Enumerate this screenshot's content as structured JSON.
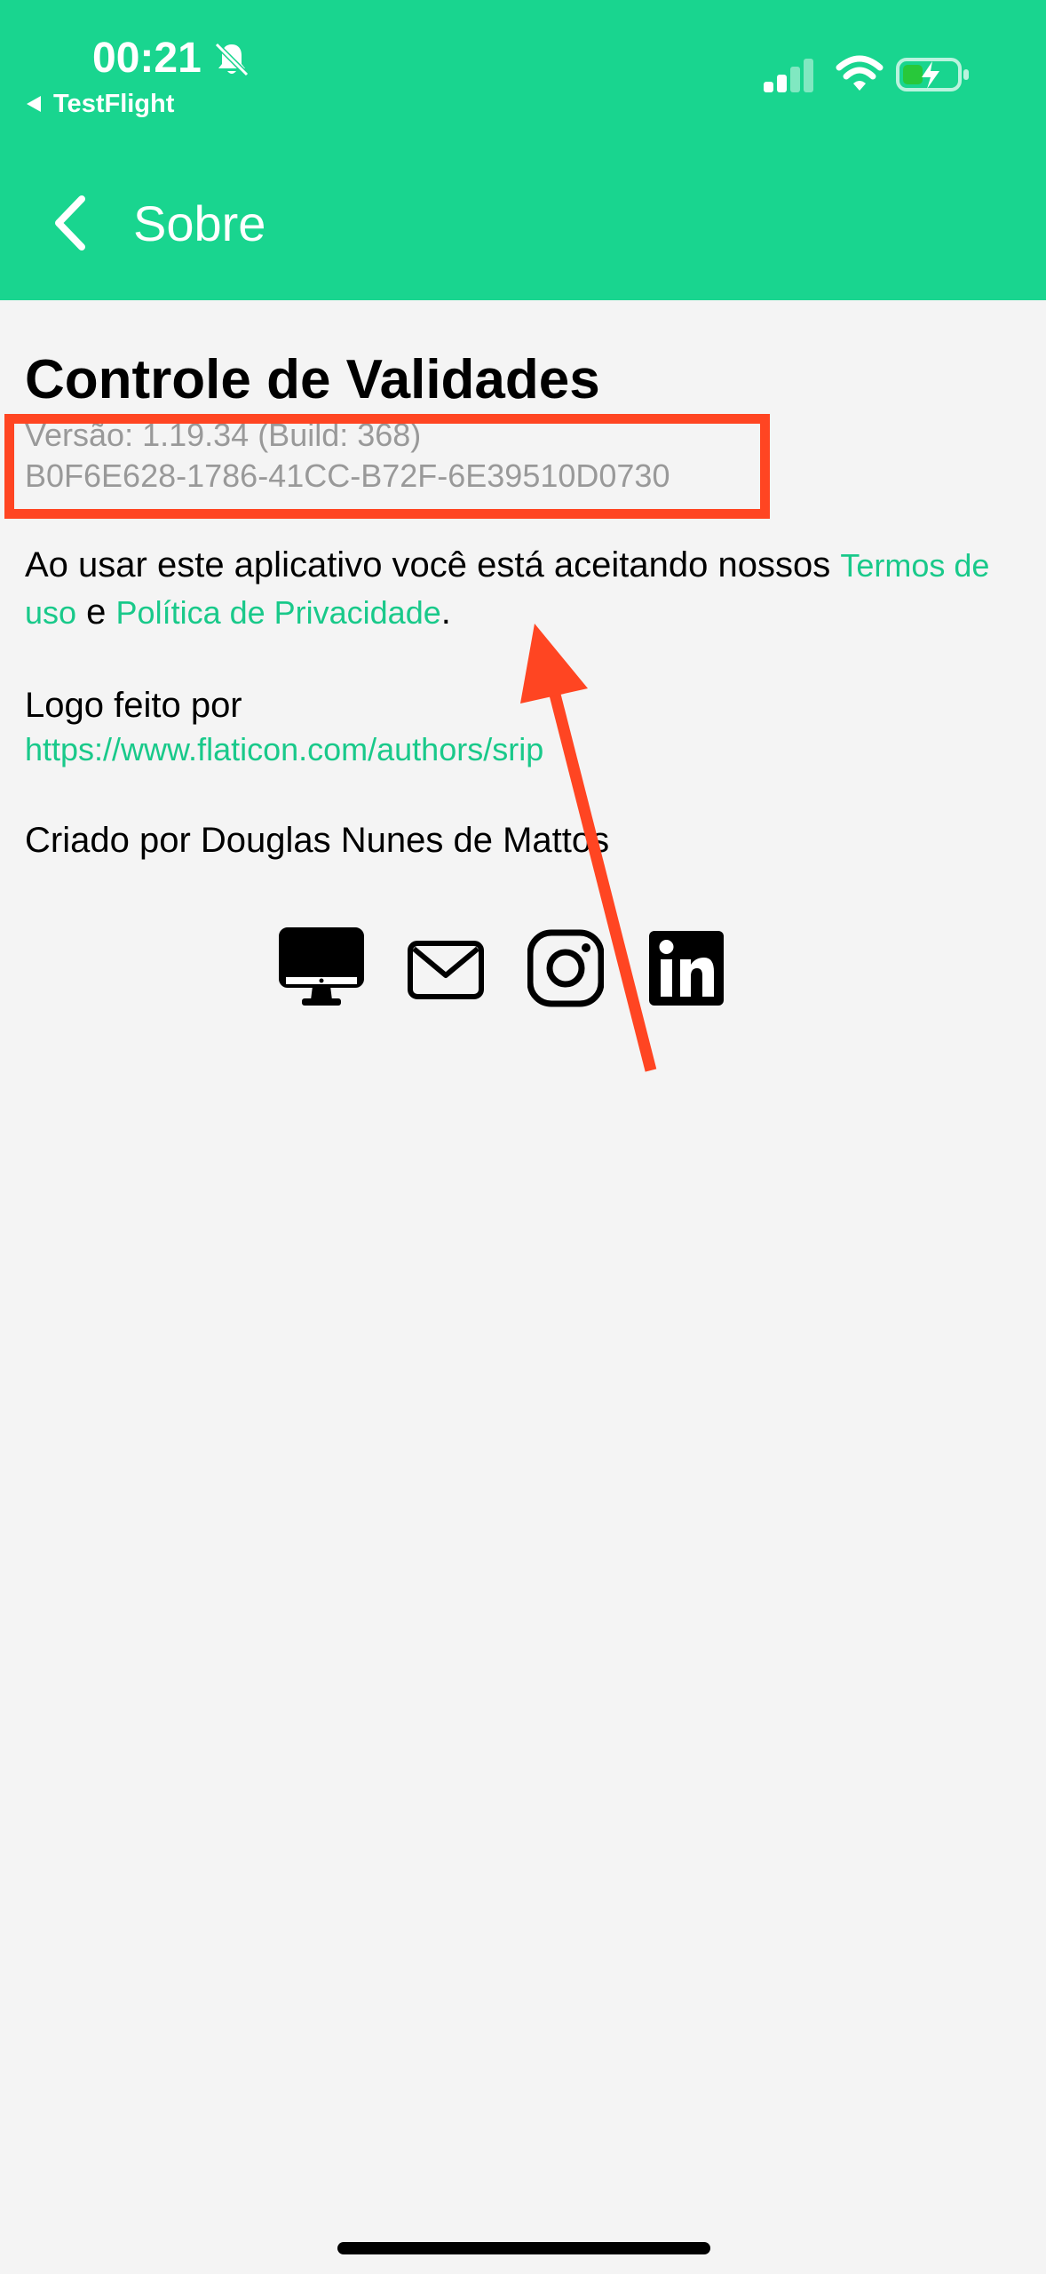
{
  "status_bar": {
    "time": "00:21",
    "back_app": "TestFlight",
    "icons": [
      "bell-slash-icon",
      "cellular-signal-icon",
      "wifi-icon",
      "battery-charging-icon"
    ]
  },
  "nav": {
    "title": "Sobre",
    "back_icon": "chevron-left-icon"
  },
  "about": {
    "app_name": "Controle de Validades",
    "version": "Versão: 1.19.34 (Build: 368)",
    "uuid": "B0F6E628-1786-41CC-B72F-6E39510D0730",
    "terms_prefix": "Ao usar este aplicativo você está aceitando nossos ",
    "terms_link": "Termos de uso",
    "terms_conj": " e ",
    "privacy_link": "Política de Privacidade",
    "terms_suffix": ".",
    "logo_by": "Logo feito por",
    "logo_url": "https://www.flaticon.com/authors/srip",
    "created_by": "Criado por Douglas Nunes de Mattos"
  },
  "social_icons": [
    "desktop-icon",
    "mail-icon",
    "instagram-icon",
    "linkedin-icon"
  ],
  "colors": {
    "header": "#19d58f",
    "link": "#19c98a",
    "annotation": "#ff4522",
    "background": "#f4f4f4"
  }
}
